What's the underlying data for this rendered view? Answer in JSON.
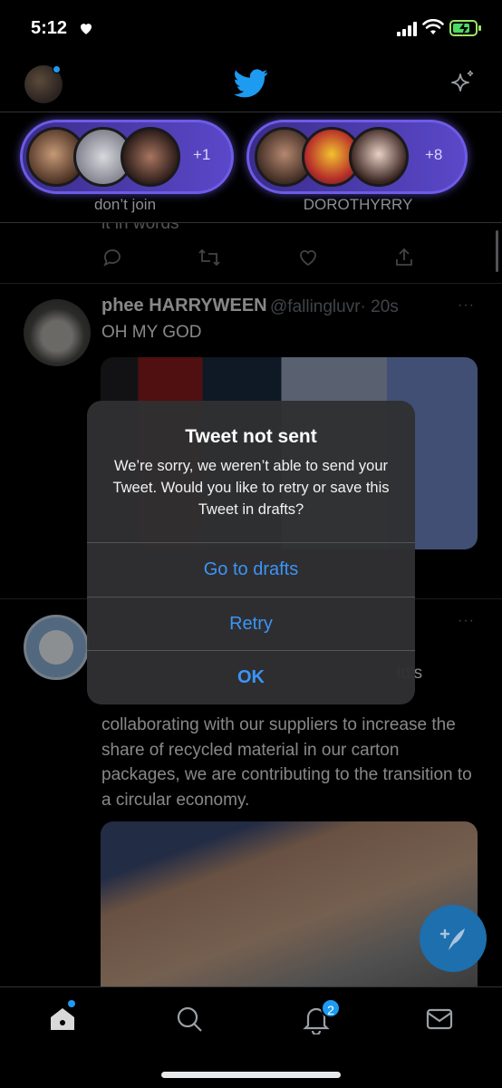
{
  "status_bar": {
    "time": "5:12"
  },
  "fleets": [
    {
      "count": "+1",
      "label": "don’t join"
    },
    {
      "count": "+8",
      "label": "DOROTHYRRY"
    }
  ],
  "feed": {
    "cut_text": "it in words",
    "tweet": {
      "name": "phee HARRYWEEN",
      "handle": "@fallingluvr",
      "time": "· 20s",
      "more": "···",
      "text": "OH MY GOD"
    },
    "ad": {
      "more": "···",
      "partial_text": "ld’s",
      "body": "collaborating with our suppliers to increase the share of recycled material in our carton packages, we are contributing to the transition to a circular economy."
    }
  },
  "alert": {
    "title": "Tweet not sent",
    "message": "We’re sorry, we weren’t able to send your Tweet. Would you like to retry or save this Tweet in drafts?",
    "buttons": [
      "Go to drafts",
      "Retry",
      "OK"
    ],
    "button_color": "#3b95f7"
  },
  "tabbar": {
    "notifications_badge": "2"
  },
  "colors": {
    "accent": "#1d9bf0",
    "fleet_ring": "#6c5ce7"
  }
}
